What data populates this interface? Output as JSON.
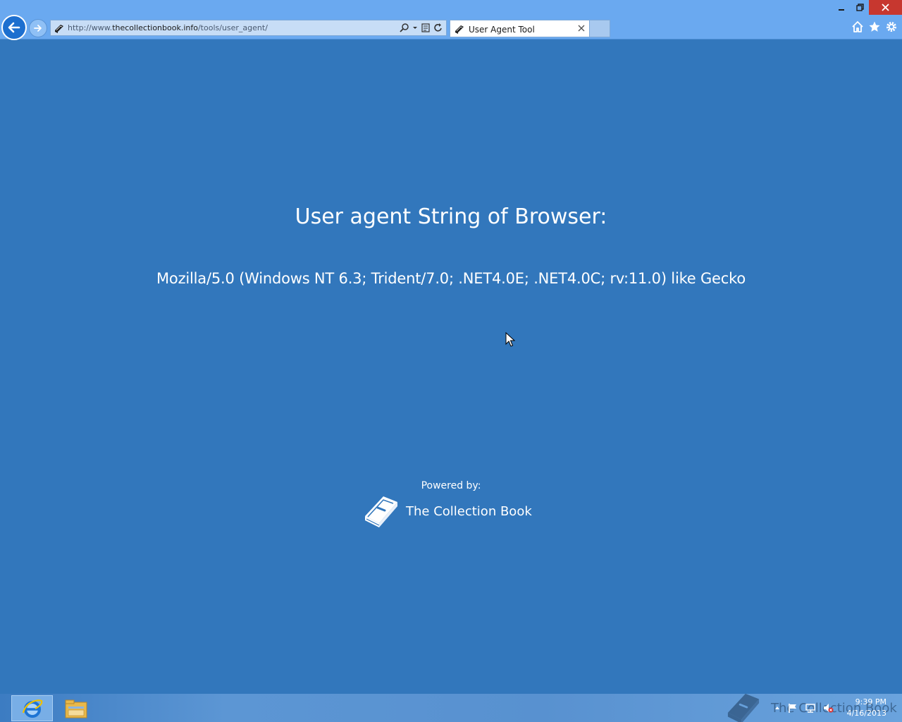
{
  "browser": {
    "url_prefix": "http://www.",
    "url_domain": "thecollectionbook.info",
    "url_path": "/tools/user_agent/",
    "tab_title": "User Agent Tool"
  },
  "page": {
    "heading": "User agent String of Browser:",
    "user_agent": "Mozilla/5.0 (Windows NT 6.3; Trident/7.0; .NET4.0E; .NET4.0C; rv:11.0) like Gecko",
    "powered_by": "Powered by:",
    "brand_name": "The Collection Book"
  },
  "taskbar": {
    "watermark": "The Collection Book",
    "time": "9:39 PM",
    "date": "4/16/2013"
  },
  "icons": {
    "back": "back-arrow-icon",
    "forward": "forward-arrow-icon",
    "site": "book-icon",
    "search": "search-icon",
    "compat": "compatibility-view-icon",
    "refresh": "refresh-icon",
    "home": "home-icon",
    "favorites": "star-icon",
    "settings": "gear-icon"
  },
  "colors": {
    "page_background": "#3277bc",
    "chrome": "#6aa9f0",
    "text": "#ffffff"
  }
}
